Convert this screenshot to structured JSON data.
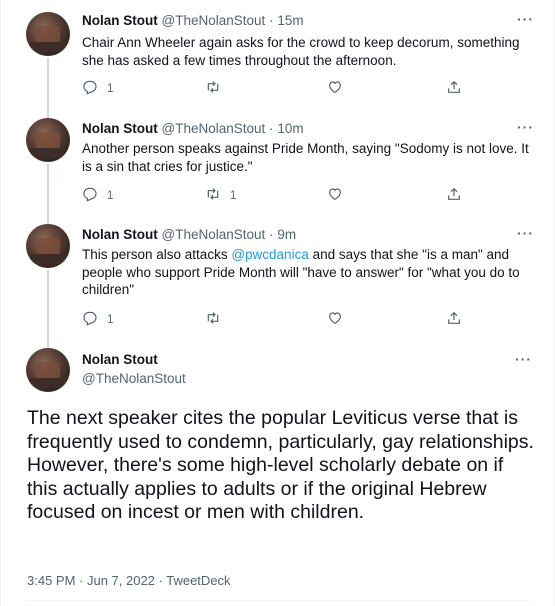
{
  "tweets": [
    {
      "name": "Nolan Stout",
      "handle": "@TheNolanStout",
      "time": "15m",
      "text": "Chair Ann Wheeler again asks for the crowd to keep decorum, something she has asked a few times throughout the afternoon.",
      "replies": "1",
      "retweets": "",
      "likes": ""
    },
    {
      "name": "Nolan Stout",
      "handle": "@TheNolanStout",
      "time": "10m",
      "text": "Another person speaks against Pride Month, saying \"Sodomy is not love. It is a sin that cries for justice.\"",
      "replies": "1",
      "retweets": "1",
      "likes": ""
    },
    {
      "name": "Nolan Stout",
      "handle": "@TheNolanStout",
      "time": "9m",
      "text_before": "This person also attacks ",
      "mention": "@pwcdanica",
      "text_after": " and says that she \"is a man\" and people who support Pride Month will \"have to answer\" for \"what you do to children\"",
      "replies": "1",
      "retweets": "",
      "likes": ""
    }
  ],
  "main_tweet": {
    "name": "Nolan Stout",
    "handle": "@TheNolanStout",
    "text": "The next speaker cites the popular Leviticus verse that is frequently used to condemn, particularly, gay relationships. However, there's some high-level scholarly debate on if this actually applies to adults or if the original Hebrew focused on incest or men with children.",
    "timestamp": "3:45 PM · Jun 7, 2022 · TweetDeck"
  },
  "separator": "·",
  "more_label": "···",
  "icons": [
    "reply-icon",
    "retweet-icon",
    "like-icon",
    "share-icon",
    "more-icon",
    "avatar"
  ],
  "colors": {
    "text": "#0f1419",
    "secondary": "#536471",
    "link": "#1d9bf0",
    "thread_line": "#cfd9de"
  }
}
